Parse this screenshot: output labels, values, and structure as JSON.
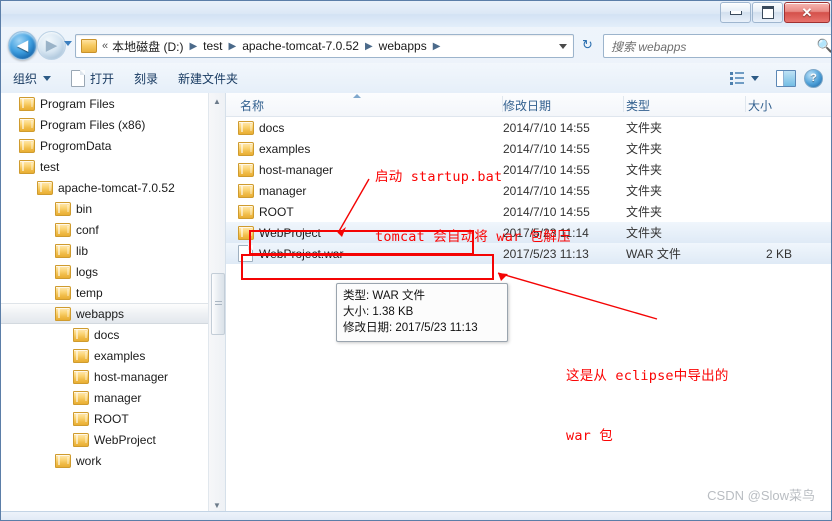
{
  "window": {
    "controls": {
      "minimize": "—",
      "maximize": "❐",
      "close": "✕"
    }
  },
  "nav": {
    "back_label": "◀",
    "forward_label": "▶",
    "recent_caret": "▾",
    "breadcrumb_prefix": "«",
    "breadcrumb": [
      "本地磁盘 (D:)",
      "test",
      "apache-tomcat-7.0.52",
      "webapps"
    ],
    "breadcrumb_caret": "▾",
    "refresh_icon": "↻",
    "search_placeholder": "搜索 webapps",
    "search_icon": "🔍"
  },
  "toolbar": {
    "organize": "组织",
    "open": "打开",
    "burn": "刻录",
    "new_folder": "新建文件夹",
    "help_label": "?"
  },
  "sidebar": {
    "items": [
      {
        "label": "Program Files",
        "indent": 0,
        "selected": false
      },
      {
        "label": "Program Files (x86)",
        "indent": 0,
        "selected": false
      },
      {
        "label": "ProgromData",
        "indent": 0,
        "selected": false
      },
      {
        "label": "test",
        "indent": 0,
        "selected": false
      },
      {
        "label": "apache-tomcat-7.0.52",
        "indent": 1,
        "selected": false
      },
      {
        "label": "bin",
        "indent": 2,
        "selected": false
      },
      {
        "label": "conf",
        "indent": 2,
        "selected": false
      },
      {
        "label": "lib",
        "indent": 2,
        "selected": false
      },
      {
        "label": "logs",
        "indent": 2,
        "selected": false
      },
      {
        "label": "temp",
        "indent": 2,
        "selected": false
      },
      {
        "label": "webapps",
        "indent": 2,
        "selected": true
      },
      {
        "label": "docs",
        "indent": 3,
        "selected": false
      },
      {
        "label": "examples",
        "indent": 3,
        "selected": false
      },
      {
        "label": "host-manager",
        "indent": 3,
        "selected": false
      },
      {
        "label": "manager",
        "indent": 3,
        "selected": false
      },
      {
        "label": "ROOT",
        "indent": 3,
        "selected": false
      },
      {
        "label": "WebProject",
        "indent": 3,
        "selected": false
      },
      {
        "label": "work",
        "indent": 2,
        "selected": false
      }
    ]
  },
  "filelist": {
    "columns": [
      "名称",
      "修改日期",
      "类型",
      "大小"
    ],
    "rows": [
      {
        "name": "docs",
        "date": "2014/7/10 14:55",
        "type": "文件夹",
        "size": "",
        "icon": "folder-icon",
        "selected": false
      },
      {
        "name": "examples",
        "date": "2014/7/10 14:55",
        "type": "文件夹",
        "size": "",
        "icon": "folder-icon",
        "selected": false
      },
      {
        "name": "host-manager",
        "date": "2014/7/10 14:55",
        "type": "文件夹",
        "size": "",
        "icon": "folder-icon",
        "selected": false
      },
      {
        "name": "manager",
        "date": "2014/7/10 14:55",
        "type": "文件夹",
        "size": "",
        "icon": "folder-icon",
        "selected": false
      },
      {
        "name": "ROOT",
        "date": "2014/7/10 14:55",
        "type": "文件夹",
        "size": "",
        "icon": "folder-icon",
        "selected": false
      },
      {
        "name": "WebProject",
        "date": "2017/5/23 11:14",
        "type": "文件夹",
        "size": "",
        "icon": "folder-icon",
        "selected": true
      },
      {
        "name": "WebProject.war",
        "date": "2017/5/23 11:13",
        "type": "WAR 文件",
        "size": "2 KB",
        "icon": "file-icon",
        "selected": true
      }
    ]
  },
  "tooltip": {
    "type_line": "类型: WAR 文件",
    "size_line": "大小: 1.38 KB",
    "date_line": "修改日期: 2017/5/23 11:13"
  },
  "annotations": {
    "note_top_line1": "启动 startup.bat",
    "note_top_line2": "tomcat 会自动将 war 包解压",
    "note_right_line1": "这是从 eclipse中导出的",
    "note_right_line2": "war 包"
  },
  "watermark": "CSDN @Slow菜鸟"
}
